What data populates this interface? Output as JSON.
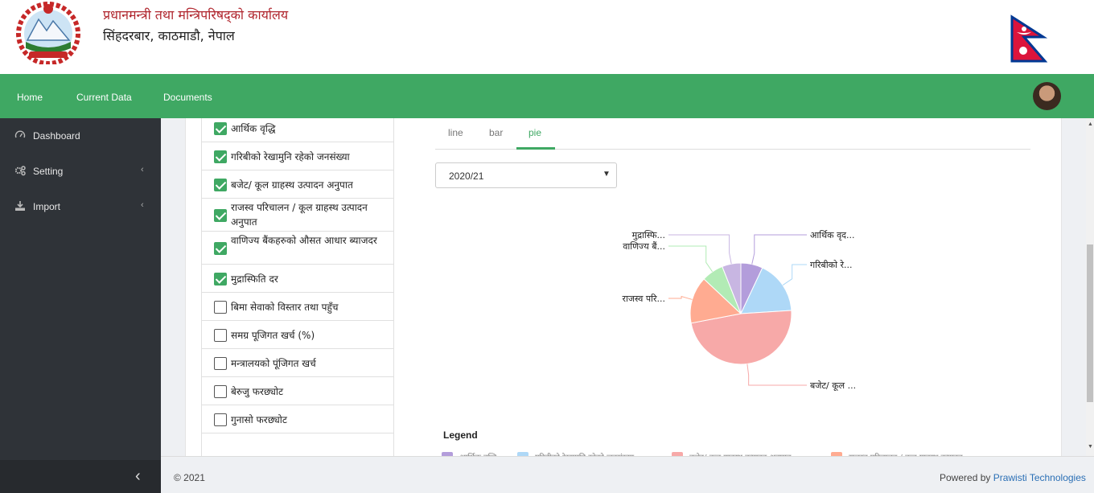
{
  "header": {
    "title": "प्रधानमन्त्री तथा मन्त्रिपरिषद्को कार्यालय",
    "subtitle": "सिंहदरबार, काठमाडौ, नेपाल"
  },
  "nav": {
    "items": [
      "Home",
      "Current Data",
      "Documents"
    ]
  },
  "sidebar": {
    "items": [
      {
        "label": "Dashboard",
        "icon": "gauge-icon"
      },
      {
        "label": "Setting",
        "icon": "gears-icon"
      },
      {
        "label": "Import",
        "icon": "download-icon"
      }
    ]
  },
  "checklist": {
    "items": [
      {
        "label": "आर्थिक वृद्धि",
        "checked": true
      },
      {
        "label": "गरिबीको रेखामुनि रहेको जनसंख्या",
        "checked": true
      },
      {
        "label": "बजेट/ कूल ग्राहस्थ उत्पादन अनुपात",
        "checked": true
      },
      {
        "label": "राजस्व परिचालन / कूल ग्राहस्थ उत्पादन अनुपात",
        "checked": true
      },
      {
        "label": "वाणिज्य बैंकहरुको औसत आधार ब्याजदर",
        "checked": true
      },
      {
        "label": "मुद्रास्फिति दर",
        "checked": true
      },
      {
        "label": "बिमा सेवाको विस्तार तथा पहुँच",
        "checked": false
      },
      {
        "label": "समग्र पूजिगत खर्च (%)",
        "checked": false
      },
      {
        "label": "मन्त्रालयको पूंजिगत खर्च",
        "checked": false
      },
      {
        "label": "बेरुजु फरछ्योट",
        "checked": false
      },
      {
        "label": "गुनासो फरछ्योट",
        "checked": false
      }
    ]
  },
  "chart_tabs": {
    "items": [
      "line",
      "bar",
      "pie"
    ],
    "active": "pie"
  },
  "year_select": {
    "value": "2020/21"
  },
  "chart_data": {
    "type": "pie",
    "slices": [
      {
        "label": "आर्थिक वृद...",
        "value": 7,
        "color": "#b39ddb"
      },
      {
        "label": "गरिबीको रे...",
        "value": 17,
        "color": "#aed8f7"
      },
      {
        "label": "बजेट/ कूल ...",
        "value": 48,
        "color": "#f7a9a8"
      },
      {
        "label": "राजस्व परि...",
        "value": 15,
        "color": "#ffab91"
      },
      {
        "label": "वाणिज्य बैं...",
        "value": 7,
        "color": "#b2ebb5"
      },
      {
        "label": "मुद्रास्फि...",
        "value": 6,
        "color": "#c8b6e2"
      }
    ],
    "legend_title": "Legend",
    "legend_items": [
      {
        "label": "आर्थिक वृद्धि",
        "color": "#b39ddb"
      },
      {
        "label": "गरिबीको रेखामुनि रहेको जनसंख्या",
        "color": "#aed8f7"
      },
      {
        "label": "बजेट/ कूल ग्राहस्थ उत्पादन अनुपात",
        "color": "#f7a9a8"
      },
      {
        "label": "राजस्व परिचालन / कूल ग्राहस्थ उत्पादन",
        "color": "#ffab91"
      }
    ]
  },
  "footer": {
    "copyright": "© 2021",
    "powered_prefix": "Powered by ",
    "powered_link": "Prawisti Technologies"
  },
  "colors": {
    "brand_green": "#3fa863",
    "sidebar_bg": "#2f3338",
    "header_red": "#b0262e"
  }
}
